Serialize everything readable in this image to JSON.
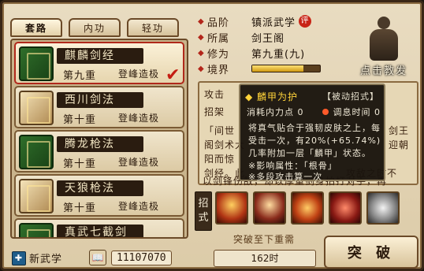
{
  "tabs": [
    "套路",
    "内功",
    "轻功"
  ],
  "skills": [
    {
      "name": "麒麟剑经",
      "level": "第九重",
      "mastery": "登峰造极",
      "book": "green",
      "selected": true
    },
    {
      "name": "西川剑法",
      "level": "第十重",
      "mastery": "登峰造极",
      "book": "scroll",
      "selected": false
    },
    {
      "name": "腾龙枪法",
      "level": "第十重",
      "mastery": "登峰造极",
      "book": "green",
      "selected": false
    },
    {
      "name": "天狼枪法",
      "level": "第十重",
      "mastery": "登峰造极",
      "book": "scroll",
      "selected": false
    },
    {
      "name": "真武七截剑",
      "level": "",
      "mastery": "",
      "book": "green",
      "selected": false
    }
  ],
  "footer": {
    "new_skill": "新武学",
    "points": "11107070"
  },
  "details": {
    "rank_label": "品阶",
    "rank": "镇派武学",
    "rank_badge": "评",
    "sect_label": "所属",
    "sect": "剑王阁",
    "cultivation_label": "修为",
    "cultivation": "第九重(九)",
    "realm_label": "境界",
    "realm_progress": 0.75
  },
  "portrait_caption": "点击教发",
  "description": {
    "line1": "攻击",
    "line2": "招架",
    "line3": "「间世",
    "line3r": "剑王",
    "line4": "阁剑术大",
    "line4r": "迎朝",
    "line5": "阳而惊",
    "line6": "剑经。此",
    "line6r": "攻敌之时不",
    "line7": "以剑锋伤敌，却以厚重剑身拍打对手，再"
  },
  "popup": {
    "title": "◆ 麟甲为护",
    "tag": "【被动招式】",
    "cost_label": "消耗内力点",
    "cost_value": "0",
    "cd_label": "调息时间",
    "cd_value": "0",
    "p1": "将真气贴合于强韧皮肤之上，每",
    "p2": "受击一次，有20%(+65.74%)",
    "p3": "几率附加一层「麟甲」状态。",
    "p4": "※影响属性：「根骨」",
    "p5": "※多段攻击算一次"
  },
  "moves_label": "招式",
  "breakthrough": {
    "need": "突破至下重需",
    "time": "162时",
    "button": "突 破"
  }
}
